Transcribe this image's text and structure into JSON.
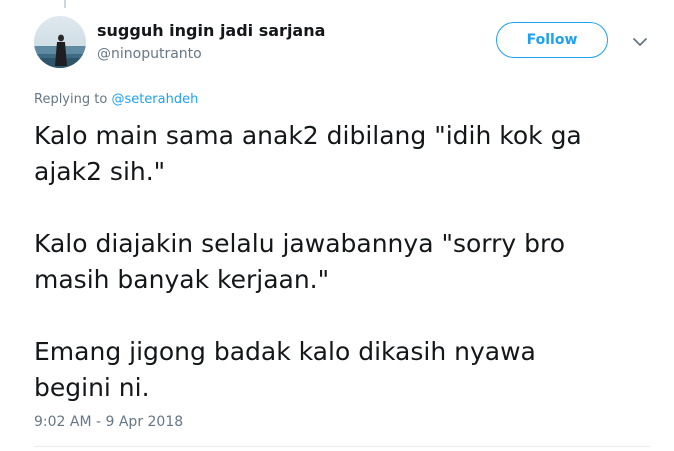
{
  "tweet": {
    "display_name": "sugguh ingin jadi sarjana",
    "username": "@ninoputranto",
    "follow_label": "Follow",
    "replying_prefix": "Replying to ",
    "replying_to": "@seterahdeh",
    "paragraphs": [
      [
        "Kalo main sama anak2 dibilang \"idih kok ga",
        "ajak2 sih.\""
      ],
      [
        "Kalo diajakin selalu jawabannya \"sorry bro",
        "masih banyak kerjaan.\""
      ],
      [
        "Emang jigong badak kalo dikasih nyawa",
        "begini ni."
      ]
    ],
    "timestamp": "9:02 AM - 9 Apr 2018"
  },
  "icons": {
    "avatar": "profile-photo",
    "caret": "chevron-down-icon"
  },
  "colors": {
    "accent": "#1da1f2",
    "text": "#14171a",
    "muted": "#657786"
  }
}
